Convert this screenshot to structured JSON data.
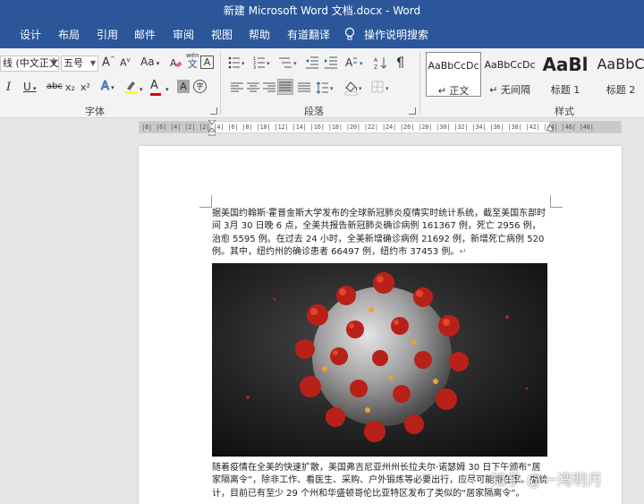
{
  "window": {
    "title": "新建 Microsoft Word 文档.docx  -  Word"
  },
  "tabs": [
    {
      "label": "设计"
    },
    {
      "label": "布局"
    },
    {
      "label": "引用"
    },
    {
      "label": "邮件"
    },
    {
      "label": "审阅"
    },
    {
      "label": "视图"
    },
    {
      "label": "帮助"
    },
    {
      "label": "有道翻译"
    },
    {
      "label": "操作说明搜索"
    }
  ],
  "font": {
    "font_name": "线 (中文正文",
    "font_size": "五号",
    "grow": "A",
    "shrink": "A",
    "case": "Aa",
    "phonetic_top": "wén",
    "phonetic_char": "文",
    "border_char": "A",
    "italic": "I",
    "underline": "U",
    "strike": "abc",
    "subscript": "x₂",
    "superscript": "x²",
    "effects": "A",
    "color": "A",
    "shade": "A",
    "enclose": "字",
    "group_label": "字体"
  },
  "paragraph": {
    "group_label": "段落"
  },
  "styles": {
    "items": [
      {
        "sample": "AaBbCcDc",
        "name": "↵ 正文"
      },
      {
        "sample": "AaBbCcDc",
        "name": "↵ 无间隔"
      },
      {
        "sample": "AaBl",
        "name": "标题 1"
      },
      {
        "sample": "AaBbC",
        "name": "标题 2"
      }
    ],
    "group_label": "样式"
  },
  "ruler": {
    "text": "|8|  |6|  |4|  |2|     |2|  |4|  |6|  |8|  |10|  |12|  |14|  |16|  |18|  |20|  |22|  |24|  |26|  |28|  |30|  |32|  |34|  |36|  |38|     |42|  |44|  |46|  |48|"
  },
  "document": {
    "para1": "据美国约翰斯·霍普金斯大学发布的全球新冠肺炎疫情实时统计系统，截至美国东部时间 3月 30 日晚 6 点，全美共报告新冠肺炎确诊病例 161367 例，死亡 2956 例，治愈 5595 例。在过去 24 小时，全美新增确诊病例 21692 例，新增死亡病例 520 例。其中，纽约州的确诊患者 66497 例，纽约市 37453 例。",
    "para2": "随着疫情在全美的快速扩散，美国弗吉尼亚州州长拉夫尔·诺瑟姆 30 日下午颁布“居家隔离令”，除非工作、看医生、采购、户外锻炼等必要出行，应尽可能待在家。据统计，目前已有至少 29 个州和华盛顿哥伦比亚特区发布了类似的“居家隔离令”。",
    "para_mark": "↵"
  },
  "watermark": "知乎 @一湾明月",
  "colors": {
    "brand": "#2b579a",
    "highlight": "#ffff00",
    "font_color": "#e00000"
  }
}
